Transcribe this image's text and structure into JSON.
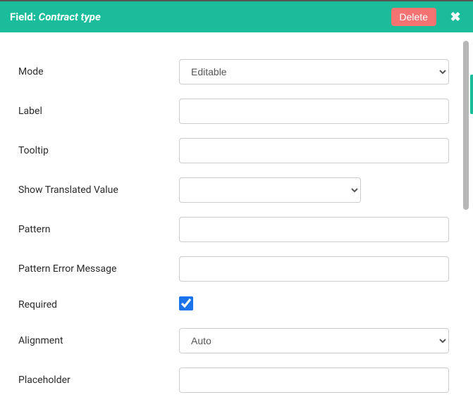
{
  "header": {
    "prefix": "Field: ",
    "value": "Contract type",
    "delete_label": "Delete"
  },
  "form": {
    "mode": {
      "label": "Mode",
      "selected": "Editable",
      "options": [
        "Editable"
      ]
    },
    "label_field": {
      "label": "Label",
      "value": ""
    },
    "tooltip": {
      "label": "Tooltip",
      "value": ""
    },
    "show_translated_value": {
      "label": "Show Translated Value",
      "selected": "",
      "options": [
        ""
      ]
    },
    "pattern": {
      "label": "Pattern",
      "value": ""
    },
    "pattern_error": {
      "label": "Pattern Error Message",
      "value": ""
    },
    "required": {
      "label": "Required",
      "checked": true
    },
    "alignment": {
      "label": "Alignment",
      "selected": "Auto",
      "options": [
        "Auto"
      ]
    },
    "placeholder": {
      "label": "Placeholder",
      "value": ""
    }
  }
}
